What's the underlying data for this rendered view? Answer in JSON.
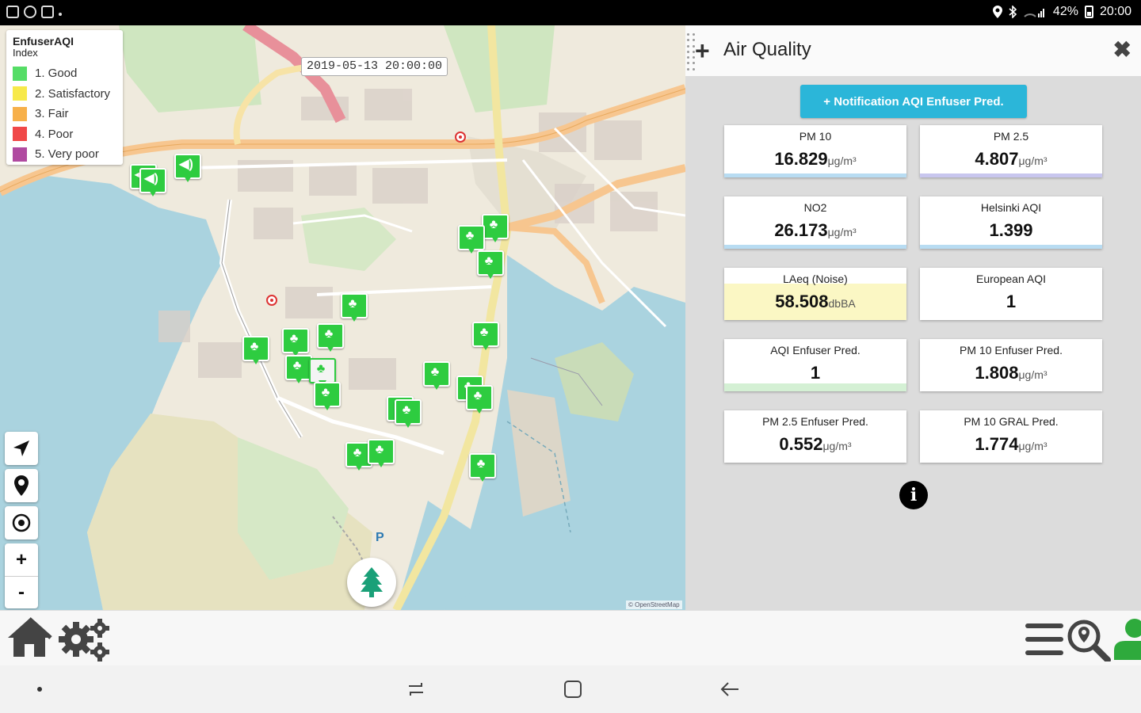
{
  "status_bar": {
    "battery": "42%",
    "time": "20:00"
  },
  "map": {
    "legend": {
      "title": "EnfuserAQI",
      "subtitle": "Index",
      "items": [
        {
          "label": "1. Good",
          "color": "#55dd66"
        },
        {
          "label": "2. Satisfactory",
          "color": "#f7e94a"
        },
        {
          "label": "3. Fair",
          "color": "#f7b04a"
        },
        {
          "label": "4. Poor",
          "color": "#f04848"
        },
        {
          "label": "5. Very poor",
          "color": "#b04aa0"
        }
      ]
    },
    "timestamp": "2019-05-13 20:00:00",
    "parking_label": "P",
    "attribution": "© OpenStreetMap",
    "controls": {
      "locate_icon": "navigation-arrow-icon",
      "pin_icon": "map-pin-icon",
      "target_icon": "crosshair-icon",
      "zoom_in": "+",
      "zoom_out": "-"
    },
    "fab_icon": "tree-icon"
  },
  "panel": {
    "title": "Air Quality",
    "close": "✖",
    "notification_button": "+ Notification AQI Enfuser Pred.",
    "cards": [
      {
        "label": "PM 10",
        "value": "16.829",
        "unit": "μg/m³",
        "bar_color": "#b8dcf2",
        "highlight": ""
      },
      {
        "label": "PM 2.5",
        "value": "4.807",
        "unit": "μg/m³",
        "bar_color": "#c8c6ee",
        "highlight": ""
      },
      {
        "label": "NO2",
        "value": "26.173",
        "unit": "μg/m³",
        "bar_color": "#b8dcf2",
        "highlight": ""
      },
      {
        "label": "Helsinki AQI",
        "value": "1.399",
        "unit": "",
        "bar_color": "#b8dcf2",
        "highlight": ""
      },
      {
        "label": "LAeq (Noise)",
        "value": "58.508",
        "unit": "dbBA",
        "bar_color": "",
        "highlight": "#fbf7c4"
      },
      {
        "label": "European AQI",
        "value": "1",
        "unit": "",
        "bar_color": "",
        "highlight": ""
      },
      {
        "label": "AQI Enfuser Pred.",
        "value": "1",
        "unit": "",
        "bar_color": "#d4f0d4",
        "highlight": ""
      },
      {
        "label": "PM 10 Enfuser Pred.",
        "value": "1.808",
        "unit": "μg/m³",
        "bar_color": "",
        "highlight": ""
      },
      {
        "label": "PM 2.5 Enfuser Pred.",
        "value": "0.552",
        "unit": "μg/m³",
        "bar_color": "",
        "highlight": ""
      },
      {
        "label": "PM 10 GRAL Pred.",
        "value": "1.774",
        "unit": "μg/m³",
        "bar_color": "",
        "highlight": ""
      }
    ],
    "info_icon": "i"
  },
  "toolbar": {
    "left_icons": [
      "home-icon",
      "settings-gears-icon"
    ],
    "right_icons": [
      "menu-icon",
      "search-location-icon",
      "user-icon"
    ]
  },
  "navbar": {
    "icons": [
      "recent-apps-icon",
      "home-square-icon",
      "back-arrow-icon"
    ]
  }
}
